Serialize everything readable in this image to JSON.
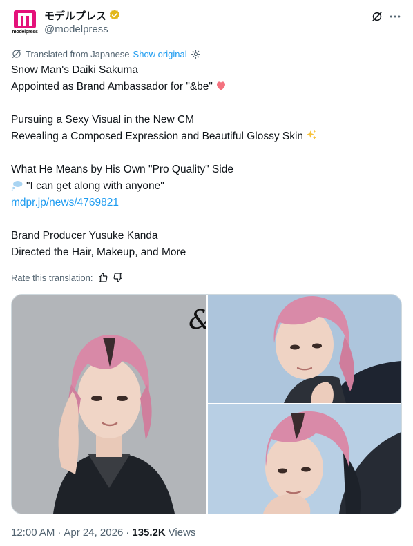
{
  "author": {
    "display_name": "モデルプレス",
    "handle": "@modelpress",
    "avatar_word": "modelpress",
    "brand_color": "#e4127a",
    "verified": true,
    "verified_color": "#e2b719"
  },
  "translation": {
    "label": "Translated from Japanese",
    "show_original": "Show original",
    "rate_label": "Rate this translation:"
  },
  "tweet": {
    "lines": [
      "Snow Man's Daiki Sakuma",
      "Appointed as Brand Ambassador for \"&be\"",
      "Pursuing a Sexy Visual in the New CM",
      "Revealing a Composed Expression and Beautiful Glossy Skin",
      "What He Means by His Own \"Pro Quality\" Side",
      "\"I can get along with anyone\"",
      "mdpr.jp/news/4769821",
      "Brand Producer Yusuke Kanda",
      "Directed the Hair, Makeup, and More"
    ],
    "emojis": [
      "heart-emoji",
      "sparkles-emoji",
      "thought-bubble-emoji"
    ]
  },
  "media": {
    "image_count": 3,
    "overlay_text": "&"
  },
  "meta": {
    "time": "12:00 AM",
    "separator": "·",
    "date": "Apr 24, 2026",
    "views_count": "135.2K",
    "views_label": "Views"
  },
  "colors": {
    "text": "#0f1419",
    "secondary": "#536471",
    "link": "#1d9bf0",
    "border": "#cfd9de"
  }
}
